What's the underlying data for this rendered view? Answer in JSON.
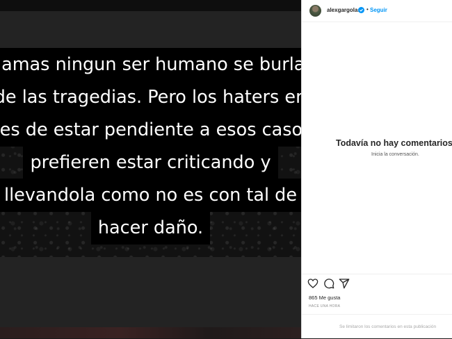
{
  "post": {
    "quote_lines": [
      "Jamas ningun ser humano se burla",
      "de las tragedias. Pero los haters en",
      "ves de estar pendiente a esos casos",
      "prefieren estar criticando y",
      "llevandola como no es con tal de",
      "hacer daño."
    ]
  },
  "header": {
    "username": "alexgargolas",
    "separator": "•",
    "follow_label": "Seguir"
  },
  "comments": {
    "empty_title": "Todavía no hay comentarios",
    "empty_subtitle": "Inicia la conversación."
  },
  "footer": {
    "likes": "865 Me gusta",
    "timestamp": "HACE UNA HORA",
    "comments_limited": "Se limitaron los comentarios en esta publicación"
  },
  "icons": {
    "like": "heart-icon",
    "comment": "comment-icon",
    "share": "share-icon",
    "verified": "verified-badge-icon"
  },
  "colors": {
    "accent": "#0095f6",
    "text": "#262626",
    "muted": "#8e8e8e"
  }
}
